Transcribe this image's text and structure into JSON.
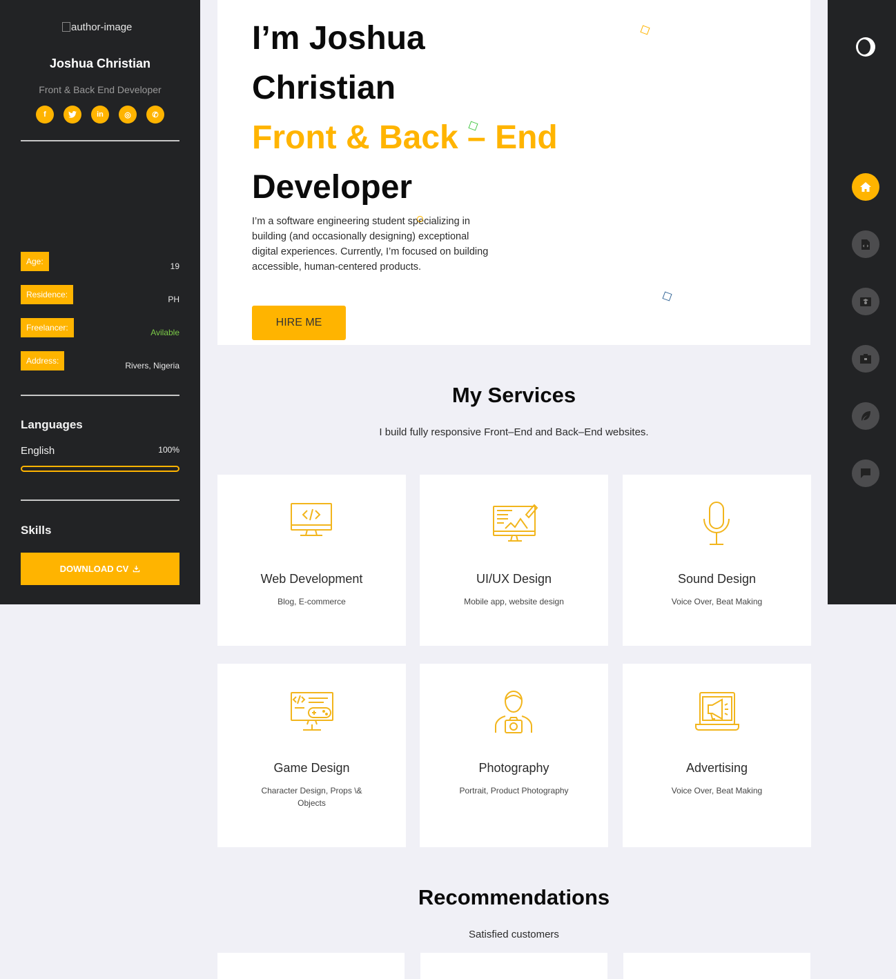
{
  "sidebar": {
    "author_image_alt": "author-image",
    "name": "Joshua Christian",
    "role": "Front & Back End Developer",
    "socials": [
      {
        "icon": "facebook-icon",
        "glyph": "f"
      },
      {
        "icon": "twitter-icon",
        "glyph": "t"
      },
      {
        "icon": "linkedin-icon",
        "glyph": "in"
      },
      {
        "icon": "instagram-icon",
        "glyph": "◎"
      },
      {
        "icon": "whatsapp-icon",
        "glyph": "✆"
      }
    ],
    "info": [
      {
        "label": "Age:",
        "value": "19"
      },
      {
        "label": "Residence:",
        "value": "PH"
      },
      {
        "label": "Freelancer:",
        "value": "Avilable"
      },
      {
        "label": "Address:",
        "value": "Rivers, Nigeria"
      }
    ],
    "languages_title": "Languages",
    "languages": [
      {
        "name": "English",
        "percent": "100%"
      }
    ],
    "skills_title": "Skills",
    "download_label": "DOWNLOAD CV"
  },
  "nav": {
    "items": [
      "home-icon",
      "resume-icon",
      "education-icon",
      "portfolio-icon",
      "blog-icon",
      "contact-icon"
    ],
    "active": "home-icon"
  },
  "hero": {
    "line1": "I’m Joshua",
    "line2": "Christian",
    "line3": "Front & Back – End",
    "line4": "Developer",
    "description": "I’m a software engineering student specializing in building (and occasionally designing) exceptional digital experiences. Currently, I’m focused on building accessible, human-centered products.",
    "hire_label": "HIRE ME"
  },
  "services": {
    "title": "My Services",
    "subtitle": "I build fully responsive Front–End and Back–End websites.",
    "items": [
      {
        "title": "Web Development",
        "sub": "Blog, E-commerce",
        "icon": "web-development-icon"
      },
      {
        "title": "UI/UX Design",
        "sub": "Mobile app, website design",
        "icon": "ui-ux-design-icon"
      },
      {
        "title": "Sound Design",
        "sub": "Voice Over, Beat Making",
        "icon": "microphone-icon"
      },
      {
        "title": "Game Design",
        "sub": "Character Design, Props \\& Objects",
        "icon": "game-design-icon"
      },
      {
        "title": "Photography",
        "sub": "Portrait, Product Photography",
        "icon": "photographer-icon"
      },
      {
        "title": "Advertising",
        "sub": "Voice Over, Beat Making",
        "icon": "megaphone-icon"
      }
    ]
  },
  "recommendations": {
    "title": "Recommendations",
    "subtitle": "Satisfied customers"
  },
  "colors": {
    "accent": "#ffb400",
    "sidebar_bg": "#222325",
    "page_bg": "#f0f0f6",
    "available": "#7ccc48"
  }
}
